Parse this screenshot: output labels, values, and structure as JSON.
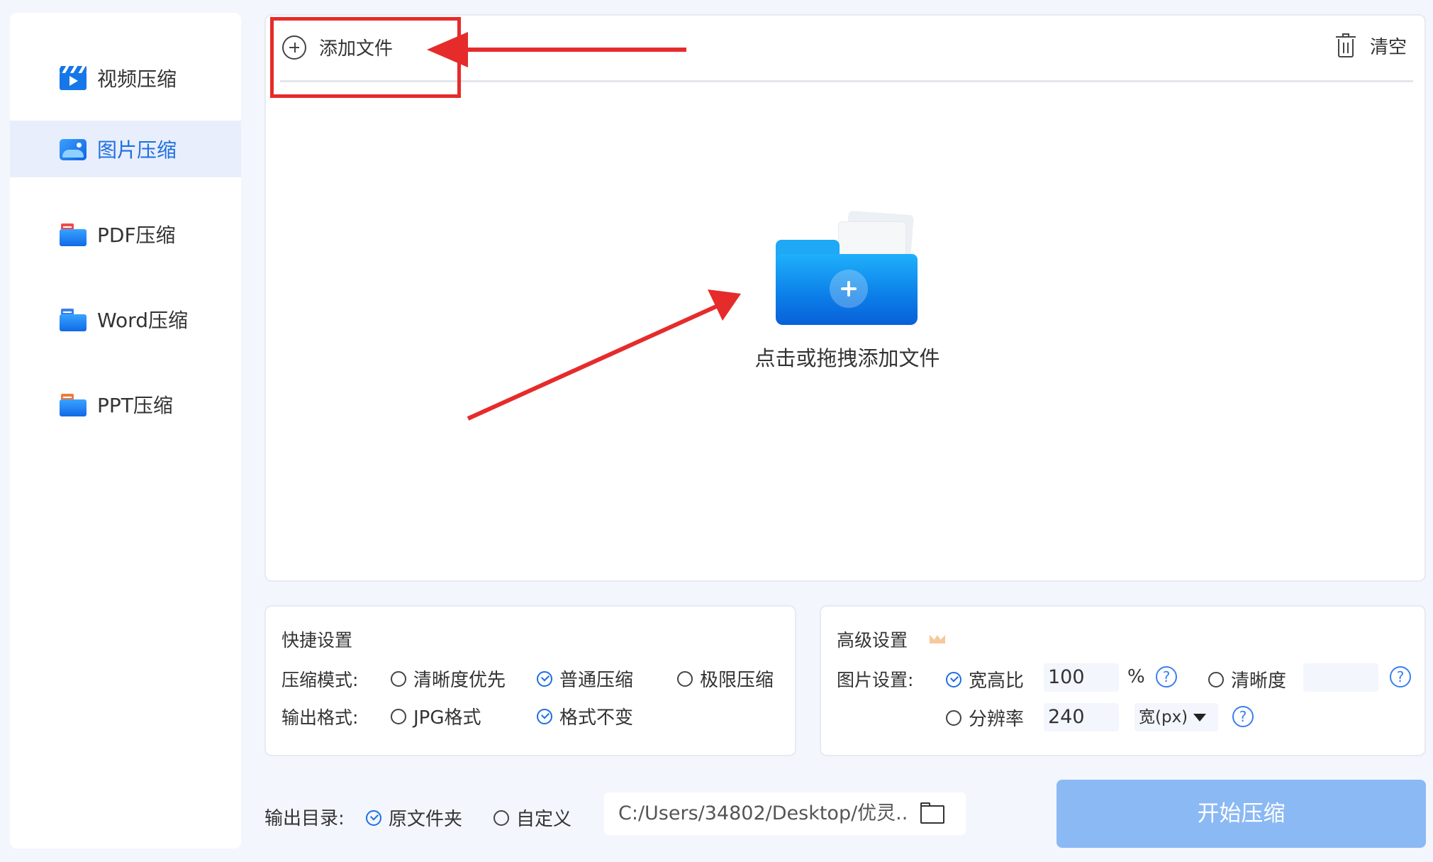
{
  "sidebar": {
    "items": [
      {
        "label": "视频压缩",
        "icon": "video-clapper-icon"
      },
      {
        "label": "图片压缩",
        "icon": "image-icon",
        "active": true
      },
      {
        "label": "PDF压缩",
        "icon": "pdf-folder-icon"
      },
      {
        "label": "Word压缩",
        "icon": "word-folder-icon"
      },
      {
        "label": "PPT压缩",
        "icon": "ppt-folder-icon"
      }
    ]
  },
  "toolbar": {
    "add_label": "添加文件",
    "clear_label": "清空"
  },
  "dropzone": {
    "label": "点击或拖拽添加文件"
  },
  "quick_settings": {
    "title": "快捷设置",
    "mode_label": "压缩模式:",
    "modes": [
      {
        "label": "清晰度优先",
        "checked": false
      },
      {
        "label": "普通压缩",
        "checked": true
      },
      {
        "label": "极限压缩",
        "checked": false
      }
    ],
    "format_label": "输出格式:",
    "formats": [
      {
        "label": "JPG格式",
        "checked": false
      },
      {
        "label": "格式不变",
        "checked": true
      }
    ]
  },
  "advanced_settings": {
    "title": "高级设置",
    "image_label": "图片设置:",
    "ratio_label": "宽高比",
    "ratio_value": "100",
    "ratio_unit": "%",
    "clarity_label": "清晰度",
    "clarity_value": "",
    "resolution_label": "分辨率",
    "resolution_value": "240",
    "resolution_unit": "宽(px)",
    "help": "?"
  },
  "output": {
    "label": "输出目录:",
    "original_folder": "原文件夹",
    "custom": "自定义",
    "path": "C:/Users/34802/Desktop/优灵.."
  },
  "start_button": "开始压缩",
  "colors": {
    "accent": "#1e6fe0",
    "annotation_red": "#e62b2b",
    "start_button": "#8bb9f4",
    "background": "#f3f6fc"
  }
}
